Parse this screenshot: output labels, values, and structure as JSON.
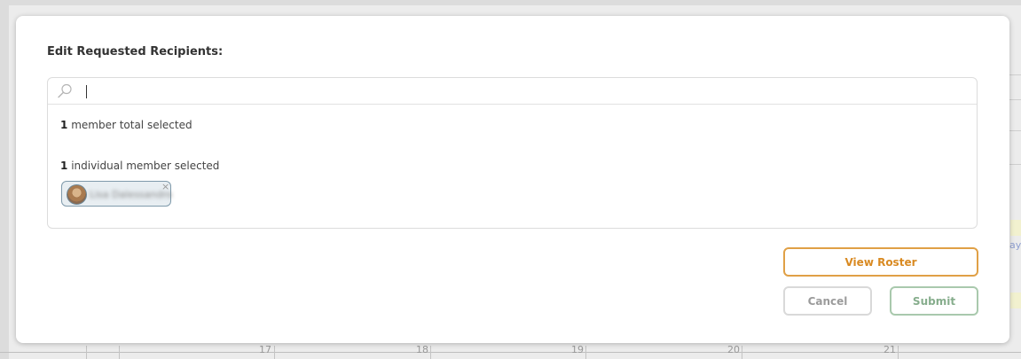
{
  "modal": {
    "title": "Edit Requested Recipients:",
    "search": {
      "value": "",
      "placeholder": ""
    },
    "summary": {
      "total_count": "1",
      "total_text": "member total selected",
      "individual_count": "1",
      "individual_text": "individual member selected"
    },
    "selected_members": [
      {
        "name": "Lisa Dalessandro",
        "remove_label": "×"
      }
    ],
    "buttons": {
      "view_roster": "View Roster",
      "cancel": "Cancel",
      "submit": "Submit"
    }
  },
  "background": {
    "calendar_days": [
      "17",
      "18",
      "19",
      "20",
      "21"
    ],
    "edge_text": "ay"
  },
  "colors": {
    "view_roster": "#d98a22",
    "submit": "#86ad8c",
    "cancel": "#9b9b9b",
    "chip_border": "#7f9aab"
  }
}
